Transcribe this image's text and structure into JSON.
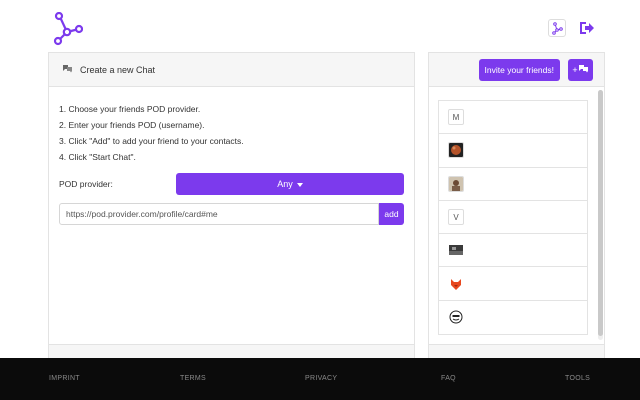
{
  "header": {
    "logo_icon": "network-logo-icon",
    "profile_icon": "share-graph-icon",
    "logout_icon": "logout-icon",
    "accent_color": "#7c3aed"
  },
  "create_chat": {
    "title": "Create a new Chat",
    "title_icon": "chat-bubbles-icon",
    "steps": [
      "1. Choose your friends POD provider.",
      "2. Enter your friends POD (username).",
      "3. Click \"Add\" to add your friend to your contacts.",
      "4. Click \"Start Chat\"."
    ],
    "pod_label": "POD provider:",
    "pod_selected": "Any",
    "url_placeholder": "https://pod.provider.com/profile/card#me",
    "add_label": "add"
  },
  "contacts_panel": {
    "invite_label": "Invite your friends!",
    "new_chat_label": "+",
    "contacts": [
      {
        "initial": "M",
        "kind": "letter"
      },
      {
        "initial": "",
        "kind": "moon-photo"
      },
      {
        "initial": "",
        "kind": "person-photo"
      },
      {
        "initial": "V",
        "kind": "letter"
      },
      {
        "initial": "",
        "kind": "landscape-photo"
      },
      {
        "initial": "",
        "kind": "fox-icon"
      },
      {
        "initial": "",
        "kind": "sketch-face"
      }
    ]
  },
  "footer": {
    "links": [
      "IMPRINT",
      "TERMS",
      "PRIVACY",
      "FAQ",
      "TOOLS"
    ]
  }
}
